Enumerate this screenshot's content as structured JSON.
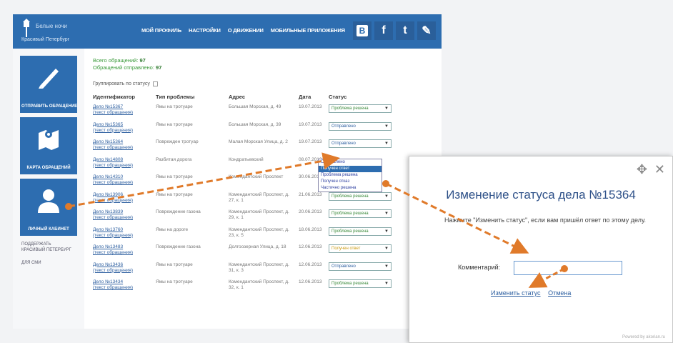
{
  "header": {
    "logo_title": "Белые ночи",
    "logo_sub": "Красивый Петербург",
    "nav": [
      "мой профиль",
      "настройки",
      "о движении",
      "мобильные приложения"
    ],
    "socials": {
      "vk": "В",
      "fb": "f",
      "tw": "t",
      "pen": "✎"
    }
  },
  "sidebar": {
    "tiles": [
      {
        "label": "Отправить обращение",
        "icon": "pen-icon"
      },
      {
        "label": "Карта обращений",
        "icon": "map-icon"
      },
      {
        "label": "Личный кабинет",
        "icon": "user-icon"
      }
    ],
    "links": [
      "Поддержать",
      "Красивый Петербург",
      "Для СМИ"
    ]
  },
  "stats": {
    "total_label": "Всего обращений:",
    "total": "97",
    "sent_label": "Обращений отправлено:",
    "sent": "97"
  },
  "group_label": "Группировать по статусу",
  "table": {
    "headers": [
      "Идентификатор",
      "Тип проблемы",
      "Адрес",
      "Дата",
      "Статус"
    ],
    "rows": [
      {
        "id": "Дело №15367",
        "text": "(текст обращения)",
        "type": "Ямы на тротуаре",
        "address": "Большая Морская, д. 49",
        "date": "19.07.2013",
        "status": "Проблема решена",
        "cls": "green"
      },
      {
        "id": "Дело №15365",
        "text": "(текст обращения)",
        "type": "Ямы на тротуаре",
        "address": "Большая Морская, д. 39",
        "date": "19.07.2013",
        "status": "Отправлено",
        "cls": "sent"
      },
      {
        "id": "Дело №15364",
        "text": "(текст обращения)",
        "type": "Поврежден тротуар",
        "address": "Малая Морская Улица, д. 2",
        "date": "19.07.2013",
        "status": "Отправлено",
        "cls": "sent"
      },
      {
        "id": "Дело №14808",
        "text": "(текст обращения)",
        "type": "Разбитая дорога",
        "address": "Кондратьевский",
        "date": "08.07.2013",
        "status": "",
        "cls": "none"
      },
      {
        "id": "Дело №14310",
        "text": "(текст обращения)",
        "type": "Ямы на тротуаре",
        "address": "Комендантский Проспект",
        "date": "30.06.2013",
        "status": "",
        "cls": "none"
      },
      {
        "id": "Дело №13906",
        "text": "(текст обращения)",
        "type": "Ямы на тротуаре",
        "address": "Комендантский Проспект, д. 27, к. 1",
        "date": "21.06.2013",
        "status": "Проблема решена",
        "cls": "green"
      },
      {
        "id": "Дело №13839",
        "text": "(текст обращения)",
        "type": "Повреждение газона",
        "address": "Комендантский Проспект, д. 29, к. 1",
        "date": "20.06.2013",
        "status": "Проблема решена",
        "cls": "green"
      },
      {
        "id": "Дело №13760",
        "text": "(текст обращения)",
        "type": "Ямы на дороге",
        "address": "Комендантский Проспект, д. 23, к. 5",
        "date": "18.06.2013",
        "status": "Проблема решена",
        "cls": "green"
      },
      {
        "id": "Дело №13483",
        "text": "(текст обращения)",
        "type": "Повреждение газона",
        "address": "Долгоозерная Улица, д. 18",
        "date": "12.06.2013",
        "status": "Получен ответ",
        "cls": "yellow"
      },
      {
        "id": "Дело №13436",
        "text": "(текст обращения)",
        "type": "Ямы на тротуаре",
        "address": "Комендантский Проспект, д. 31, к. 3",
        "date": "12.06.2013",
        "status": "Отправлено",
        "cls": "sent"
      },
      {
        "id": "Дело №13434",
        "text": "(текст обращения)",
        "type": "Ямы на тротуаре",
        "address": "Комендантский Проспект, д. 32, к. 1",
        "date": "12.06.2013",
        "status": "Проблема решена",
        "cls": "green"
      }
    ]
  },
  "dropdown_options": [
    "Отправлено",
    "Получен ответ",
    "Проблема решена",
    "Получен отказ",
    "Частично решена"
  ],
  "dropdown_highlight": 1,
  "modal": {
    "title": "Изменение статуса дела №15364",
    "text": "Нажмите \"Изменить статус\", если вам пришёл ответ по этому делу.",
    "comment_label": "Комментарий:",
    "change_link": "Изменить статус",
    "cancel_link": "Отмена",
    "powered": "Powered by akorian.ru"
  },
  "colors": {
    "brand": "#2d6db0",
    "arrow": "#e07a2a",
    "green": "#3a9a3a"
  }
}
